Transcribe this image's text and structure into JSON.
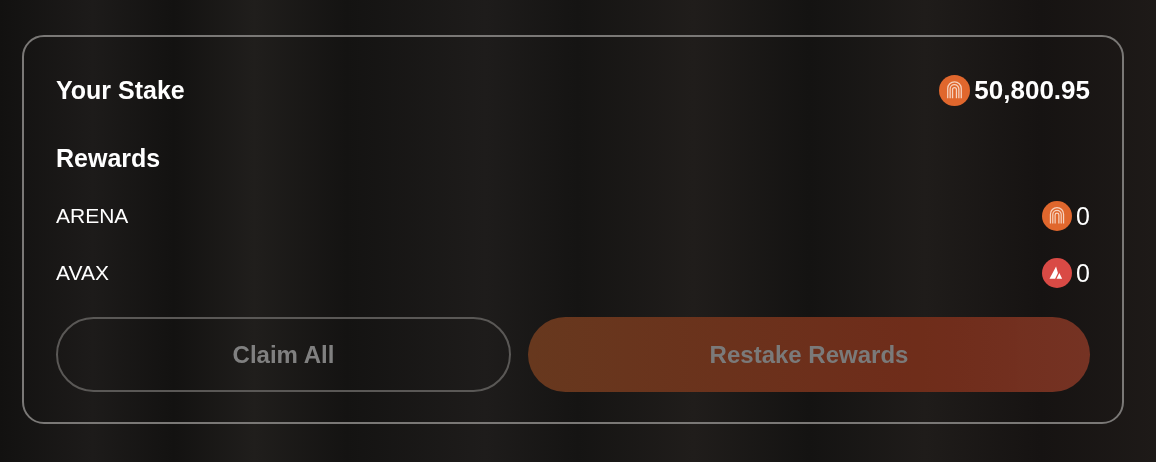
{
  "stake": {
    "label": "Your Stake",
    "kind": "arena",
    "amount": "50,800.95"
  },
  "rewards": {
    "title": "Rewards",
    "items": [
      {
        "name": "ARENA",
        "kind": "arena",
        "amount": "0"
      },
      {
        "name": "AVAX",
        "kind": "avax",
        "amount": "0"
      }
    ]
  },
  "buttons": [
    {
      "label": "Claim All",
      "kind": "outline",
      "disabled": true
    },
    {
      "label": "Restake Rewards",
      "kind": "primary",
      "disabled": true
    }
  ]
}
